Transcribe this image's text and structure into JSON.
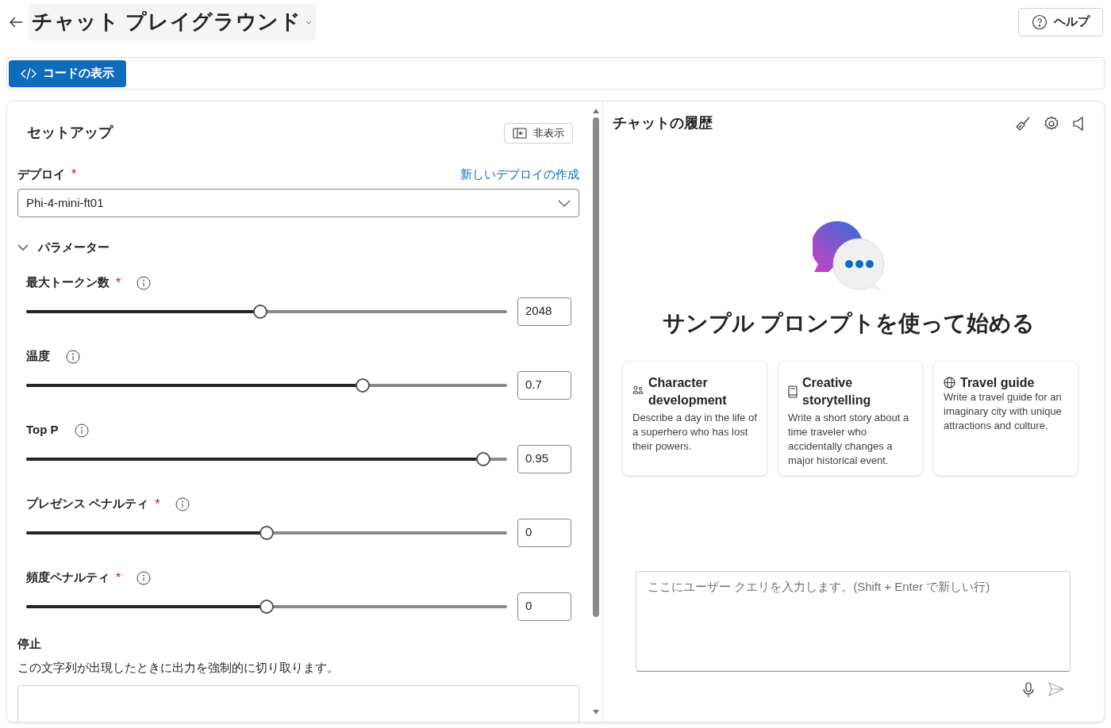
{
  "header": {
    "title": "チャット プレイグラウンド",
    "help_button": "ヘルプ"
  },
  "toolbar": {
    "view_code_button": "コードの表示"
  },
  "setup": {
    "title": "セットアップ",
    "hide_button": "非表示",
    "deploy": {
      "label": "デプロイ",
      "required_mark": "*",
      "create_link": "新しいデプロイの作成",
      "value": "Phi-4-mini-ft01"
    },
    "parameters": {
      "label": "パラメーター",
      "expanded": true,
      "sliders": [
        {
          "label": "最大トークン数",
          "required_mark": "*",
          "level": 0.486,
          "value": "2048"
        },
        {
          "label": "温度",
          "level": 0.7,
          "value": "0.7"
        },
        {
          "label": "Top P",
          "level": 0.95,
          "value": "0.95"
        },
        {
          "label": "プレゼンス ペナルティ",
          "required_mark": "*",
          "level": 0.5,
          "value": "0"
        },
        {
          "label": "頻度ペナルティ",
          "required_mark": "*",
          "level": 0.5,
          "value": "0"
        }
      ]
    },
    "stop": {
      "label": "停止",
      "description": "この文字列が出現したときに出力を強制的に切り取ります。"
    }
  },
  "chat": {
    "title": "チャットの履歴",
    "heading": "サンプル プロンプトを使って始める",
    "prompts": [
      {
        "kind": "people",
        "title": "Character development",
        "text": "Describe a day in the life of a superhero who has lost their powers."
      },
      {
        "kind": "book",
        "title": "Creative storytelling",
        "text": "Write a short story about a time traveler who accidentally changes a major historical event."
      },
      {
        "kind": "globe",
        "title": "Travel guide",
        "text": "Write a travel guide for an imaginary city with unique attractions and culture."
      }
    ],
    "input": {
      "placeholder": "ここにユーザー クエリを入力します。(Shift + Enter で新しい行)"
    }
  }
}
